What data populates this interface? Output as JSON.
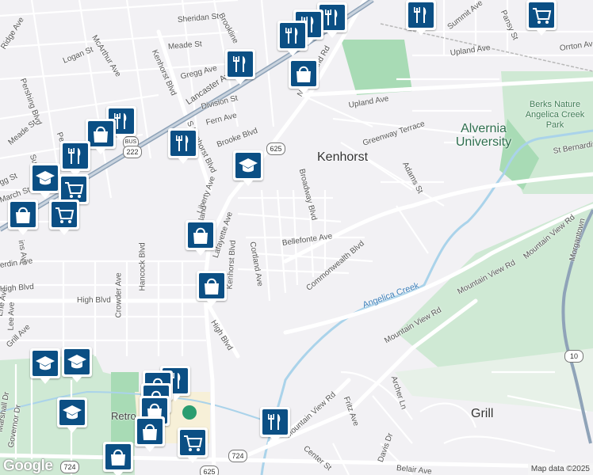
{
  "attribution": "Map data ©2025",
  "logo": "Google",
  "places": {
    "kenhorst": "Kenhorst",
    "grill": "Grill",
    "alvernia": "Alvernia University",
    "berks_park": "Berks Nature Angelica Creek Park",
    "angelica_creek": "Angelica Creek",
    "retro": "Retro"
  },
  "roads": {
    "ridge_ave": "Ridge Ave",
    "logan_st": "Logan St",
    "mcarthur_ave": "McArthur Ave",
    "sheridan_st": "Sheridan St",
    "brookline": "Brookline",
    "meade_st_top": "Meade St",
    "gregg_ave": "Gregg Ave",
    "pershing_blvd": "Pershing Blvd",
    "kenhorst_blvd_n": "Kenhorst Blvd",
    "lancaster_ave": "Lancaster Ave",
    "division_st": "Division St",
    "fern_ave": "Fern Ave",
    "s_kenhorst_blvd": "S Kenhorst Blvd",
    "brooke_blvd": "Brooke Blvd",
    "new_holland_rd": "New Holland Rd",
    "upland_ave": "Upland Ave",
    "upland_ave_ne": "Upland Ave",
    "summit_ave": "Summit Ave",
    "pansy_st": "Pansy St",
    "orrton_ave": "Orrton Ave",
    "greenway_ter": "Greenway Terrace",
    "st_bernardine": "St Bernardine",
    "adams_st": "Adams St",
    "broadway_blvd": "Broadway Blvd",
    "liberty_ave": "Liberty Ave",
    "bellefonte_ave": "Bellefonte Ave",
    "commonwealth_blvd": "Commonwealth Blvd",
    "cortland_ave": "Cortland Ave",
    "lafayette_ave": "Lafayette Ave",
    "kenhorst_blvd_s": "Kenhorst Blvd",
    "hancock_blvd": "Hancock Blvd",
    "crowder_ave": "Crowder Ave",
    "high_blvd_w": "High Blvd",
    "high_blvd": "High Blvd",
    "high_blvd_diag": "High Blvd",
    "meade_st_w": "Meade St",
    "march_st": "March St",
    "gg_st": "gg St",
    "erdin_ave": "erdin Ave",
    "lee_ave": "Lee Ave",
    "erie_ave": "Erie Ave",
    "grill_ave": "Grill Ave",
    "marshall_dr": "Marshall Dr",
    "governor_dr": "Governor Dr",
    "mountain_view_rd_a": "Mountain View Rd",
    "mountain_view_rd_b": "Mountain View Rd",
    "mountain_view_rd_c": "Mountain View Rd",
    "mountain_view_rd_d": "Mountain View Rd",
    "morgantown": "Morgantown",
    "archer_ln": "Archer Ln",
    "fritz_ave": "Fritz Ave",
    "center_st": "Center St",
    "davis_dr": "Davis Dr",
    "belair_ave": "Belair Ave",
    "pershi": "Persh",
    "sum": "Sum",
    "ins_ave": "ins Ave",
    "new_holland_s": "New Holland"
  },
  "shields": {
    "bus": "BUS",
    "r222": "222",
    "r625": "625",
    "r625b": "625",
    "r724a": "724",
    "r724b": "724",
    "r10": "10"
  },
  "colors": {
    "background": "#f2f1f4",
    "park": "#cfe9d4",
    "green_dark": "#a8dbb5",
    "water": "#aad3ea",
    "pin": "#0b4f84",
    "highway": "#8fa3b8"
  },
  "markers": [
    {
      "icon": "restaurant-icon"
    },
    {
      "icon": "restaurant-icon"
    },
    {
      "icon": "restaurant-icon"
    },
    {
      "icon": "restaurant-icon"
    },
    {
      "icon": "shopping-cart-icon"
    },
    {
      "icon": "restaurant-icon"
    },
    {
      "icon": "shopping-bag-icon"
    },
    {
      "icon": "restaurant-icon"
    },
    {
      "icon": "shopping-bag-icon"
    },
    {
      "icon": "restaurant-icon"
    },
    {
      "icon": "restaurant-icon"
    },
    {
      "icon": "school-icon"
    },
    {
      "icon": "school-icon"
    },
    {
      "icon": "shopping-cart-icon"
    },
    {
      "icon": "shopping-cart-icon"
    },
    {
      "icon": "shopping-bag-icon"
    },
    {
      "icon": "shopping-bag-icon"
    },
    {
      "icon": "shopping-bag-icon"
    },
    {
      "icon": "school-icon"
    },
    {
      "icon": "school-icon"
    },
    {
      "icon": "school-icon"
    },
    {
      "icon": "restaurant-icon"
    },
    {
      "icon": "shopping-bag-icon"
    },
    {
      "icon": "shopping-bag-icon"
    },
    {
      "icon": "shopping-bag-icon"
    },
    {
      "icon": "shopping-bag-icon"
    },
    {
      "icon": "shopping-cart-icon"
    },
    {
      "icon": "shopping-bag-icon"
    },
    {
      "icon": "restaurant-icon"
    }
  ]
}
